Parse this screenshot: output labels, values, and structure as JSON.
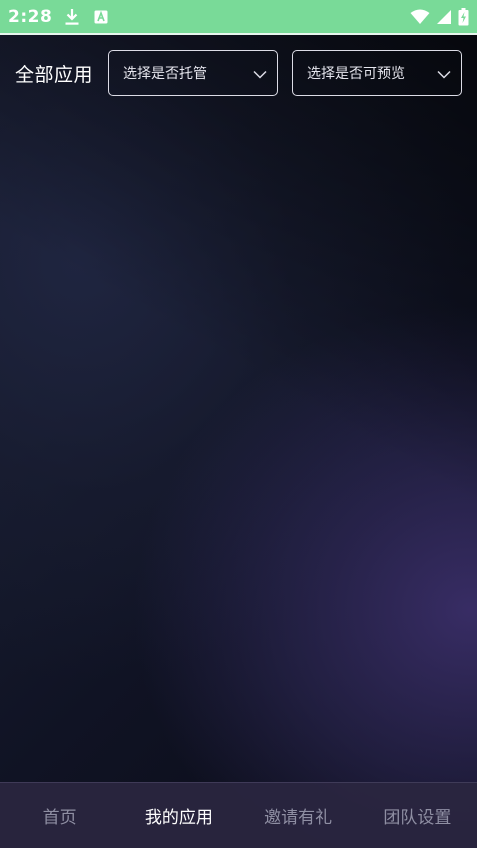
{
  "status_bar": {
    "time": "2:28",
    "icons": [
      "download-icon",
      "a-letter-icon",
      "wifi-icon",
      "signal-icon",
      "battery-charging-icon"
    ],
    "background": "#79da98"
  },
  "header": {
    "title": "全部应用",
    "filters": [
      {
        "placeholder": "选择是否托管",
        "icon": "chevron-down-icon"
      },
      {
        "placeholder": "选择是否可预览",
        "icon": "chevron-down-icon"
      }
    ]
  },
  "bottom_nav": {
    "items": [
      {
        "label": "首页",
        "active": false
      },
      {
        "label": "我的应用",
        "active": true
      },
      {
        "label": "邀请有礼",
        "active": false
      },
      {
        "label": "团队设置",
        "active": false
      }
    ],
    "active_color": "#ffffff",
    "inactive_color": "#8f8fa3"
  },
  "theme": {
    "background": "#0d0f1c",
    "accent_glow": "#3a2e68"
  }
}
